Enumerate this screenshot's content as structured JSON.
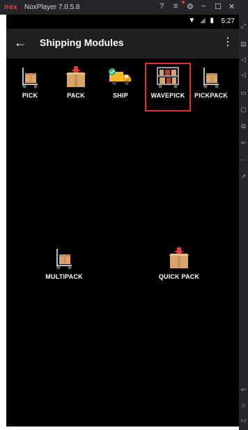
{
  "emulator": {
    "logo": "nox",
    "title": "NoxPlayer 7.0.5.8",
    "controls": [
      "?",
      "≡",
      "⚙",
      "−",
      "☐",
      "✕"
    ]
  },
  "status_bar": {
    "time": "5:27",
    "icons": [
      "wifi-icon",
      "signal-icon",
      "battery-icon"
    ]
  },
  "app_bar": {
    "title": "Shipping Modules",
    "back_icon": "arrow-left-icon",
    "menu_icon": "more-vert-icon"
  },
  "modules": [
    {
      "label": "PICK",
      "icon": "hand-truck-box-icon"
    },
    {
      "label": "PACK",
      "icon": "box-down-arrow-icon"
    },
    {
      "label": "SHIP",
      "icon": "delivery-truck-icon"
    },
    {
      "label": "WAVEPICK",
      "icon": "shelf-cart-icon",
      "selected": true
    },
    {
      "label": "PICKPACK",
      "icon": "hand-truck-box-icon"
    },
    {
      "label": "MULTIPACK",
      "icon": "hand-truck-box-icon"
    },
    {
      "label": "QUICK PACK",
      "icon": "box-down-arrow-icon"
    }
  ],
  "colors": {
    "screen_bg": "#000000",
    "appbar_bg": "#202020",
    "box": "#d8a56a",
    "highlight": "#e03030",
    "arrow": "#e53935"
  }
}
